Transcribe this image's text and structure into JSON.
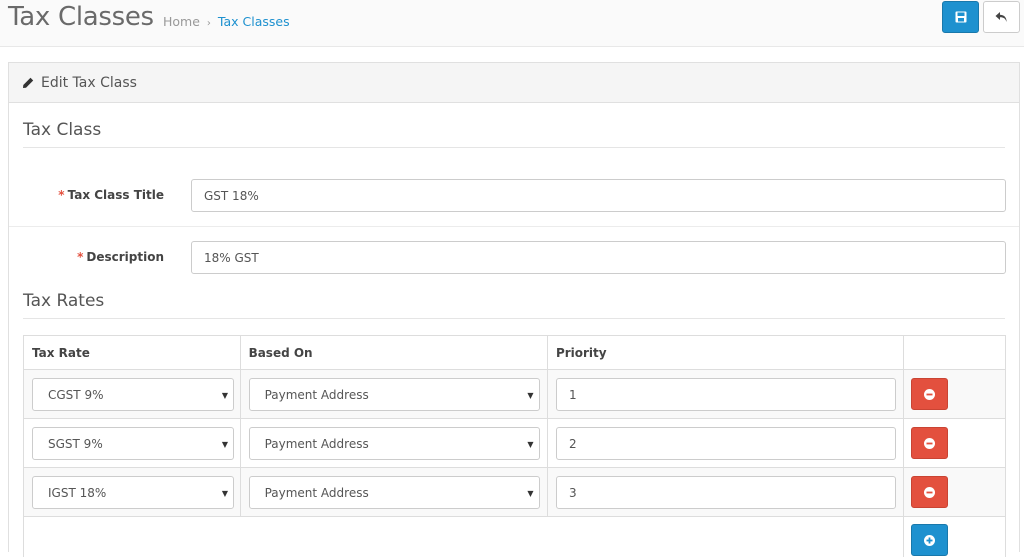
{
  "header": {
    "title": "Tax Classes",
    "breadcrumb": [
      {
        "label": "Home"
      },
      {
        "label": "Tax Classes"
      }
    ],
    "breadcrumb_sep": "›"
  },
  "panel": {
    "heading": "Edit Tax Class"
  },
  "tax_class": {
    "legend": "Tax Class",
    "title_label": "Tax Class Title",
    "title_value": "GST 18%",
    "description_label": "Description",
    "description_value": "18% GST",
    "required_mark": "*"
  },
  "tax_rates": {
    "legend": "Tax Rates",
    "columns": [
      "Tax Rate",
      "Based On",
      "Priority",
      ""
    ],
    "rows": [
      {
        "tax_rate": "CGST 9%",
        "based_on": "Payment Address",
        "priority": "1"
      },
      {
        "tax_rate": "SGST 9%",
        "based_on": "Payment Address",
        "priority": "2"
      },
      {
        "tax_rate": "IGST 18%",
        "based_on": "Payment Address",
        "priority": "3"
      }
    ]
  },
  "icons": {
    "save": "save-icon",
    "back": "reply-icon",
    "edit": "pencil-icon",
    "remove": "minus-circle-icon",
    "add": "plus-circle-icon",
    "caret": "▼"
  },
  "colors": {
    "primary": "#1e91cf",
    "danger": "#e3503e",
    "required": "#e3503e"
  }
}
